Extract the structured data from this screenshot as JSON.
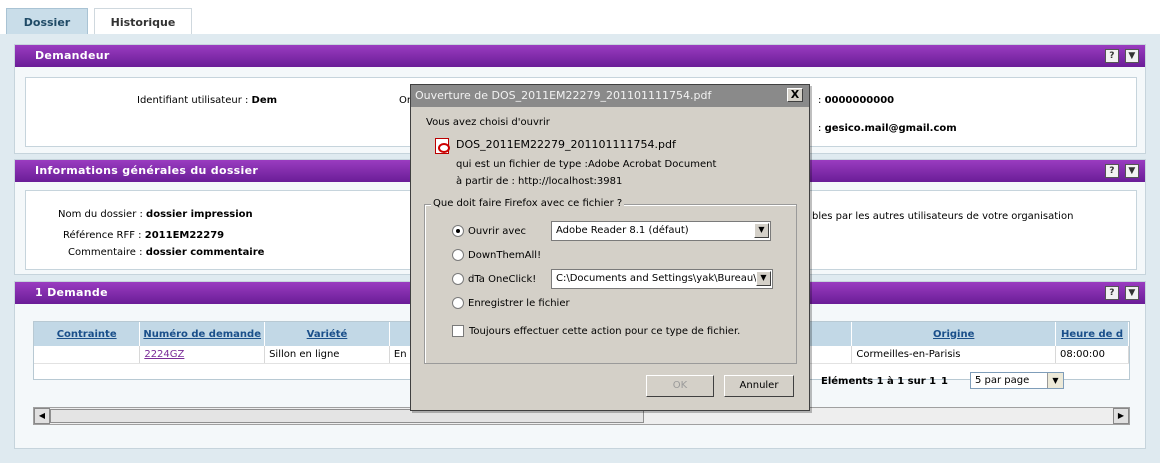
{
  "tabs": [
    {
      "label": "Dossier"
    },
    {
      "label": "Historique"
    }
  ],
  "demandeur": {
    "title": "Demandeur",
    "identifiant_label": "Identifiant utilisateur :",
    "identifiant_value": "Dem",
    "partial_label": "Or",
    "phone_label": ":",
    "phone_value": "0000000000",
    "email_label": ":",
    "email_value": "gesico.mail@gmail.com"
  },
  "infos": {
    "title": "Informations générales du dossier",
    "nom_label": "Nom du dossier :",
    "nom_value": "dossier impression",
    "ref_label": "Référence RFF :",
    "ref_value": "2011EM22279",
    "commentaire_label": "Commentaire :",
    "commentaire_value": "dossier commentaire",
    "visibility_text": "bles par les autres utilisateurs de votre organisation"
  },
  "demandes": {
    "title": "1 Demande",
    "columns": [
      "Contrainte",
      "Numéro de demande",
      "Variété",
      "",
      "Origine",
      "Heure de d"
    ],
    "rows": [
      {
        "contrainte": "",
        "numero": "2224GZ",
        "variete": "Sillon en ligne",
        "col4": "En c",
        "origine": "Cormeilles-en-Parisis",
        "heure": "08:00:00"
      }
    ],
    "pager_text": "Eléments 1 à 1 sur 1",
    "page": "1",
    "per_page": "5 par page"
  },
  "panel_buttons": {
    "help": "?",
    "collapse": "▼"
  },
  "dialog": {
    "title": "Ouverture de DOS_2011EM22279_201101111754.pdf",
    "close": "X",
    "intro": "Vous avez choisi d'ouvrir",
    "filename": "DOS_2011EM22279_201101111754.pdf",
    "type_label": "qui est un fichier de type :",
    "type_value": "Adobe Acrobat Document",
    "from_label": "à partir de :",
    "from_value": "http://localhost:3981",
    "group_title": "Que doit faire Firefox avec ce fichier ?",
    "opt_open": "Ouvrir avec",
    "open_app": "Adobe Reader 8.1 (défaut)",
    "opt_downthemall": "DownThemAll!",
    "opt_dta": "dTa OneClick!",
    "dta_path": "C:\\Documents and Settings\\yak\\Bureau\\",
    "opt_save": "Enregistrer le fichier",
    "always_label": "Toujours effectuer cette action pour ce type de fichier.",
    "ok_label": "OK",
    "cancel_label": "Annuler",
    "selected_option": "open"
  }
}
